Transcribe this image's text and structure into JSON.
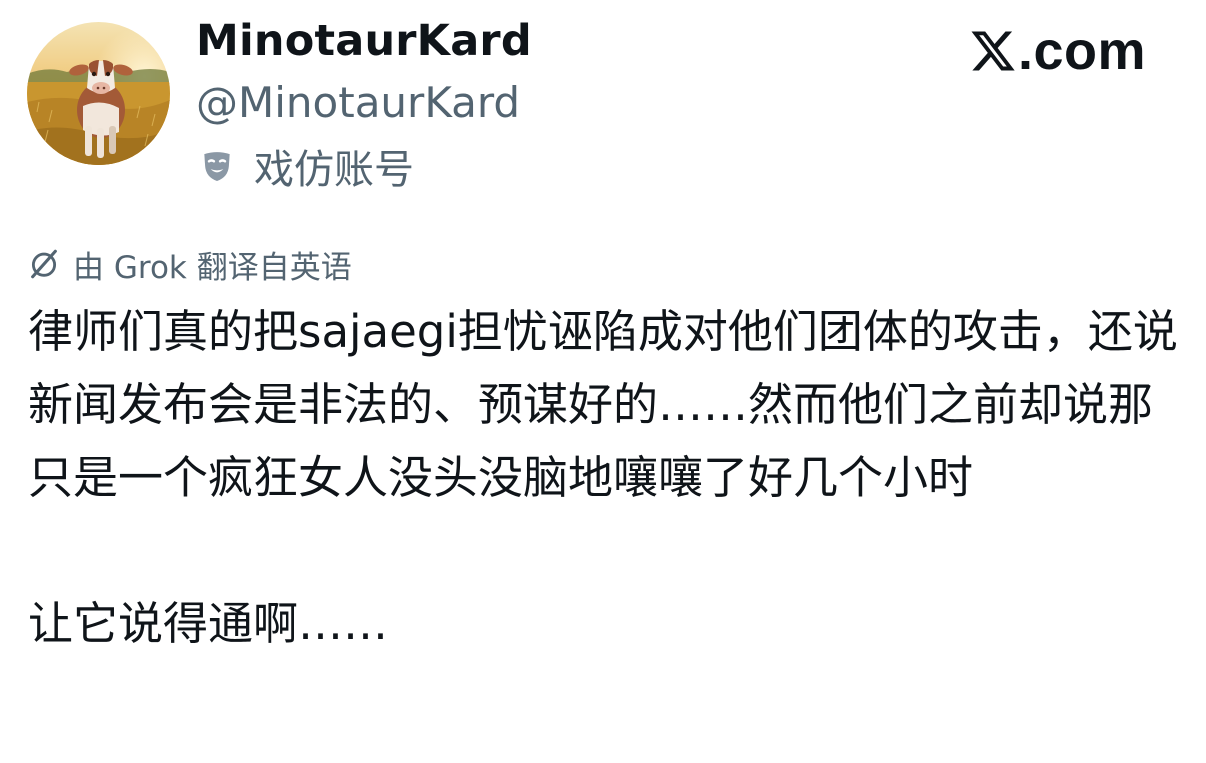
{
  "author": {
    "display_name": "MinotaurKard",
    "handle": "@MinotaurKard",
    "label": "戏仿账号",
    "label_icon": "parody-mask-icon",
    "avatar": "calf-in-field-avatar"
  },
  "site": {
    "logo_icon": "x-logo-icon",
    "text": ".com"
  },
  "translation": {
    "icon": "grok-icon",
    "text": "由 Grok 翻译自英语"
  },
  "tweet": {
    "paragraphs": [
      "律师们真的把sajaegi担忧诬陷成对他们团体的攻击，还说新闻发布会是非法的、预谋好的……然而他们之前却说那只是一个疯狂女人没头没脑地嚷嚷了好几个小时",
      "让它说得通啊……"
    ]
  },
  "colors": {
    "text_primary": "#0f1419",
    "text_secondary": "#536471",
    "background": "#ffffff"
  }
}
